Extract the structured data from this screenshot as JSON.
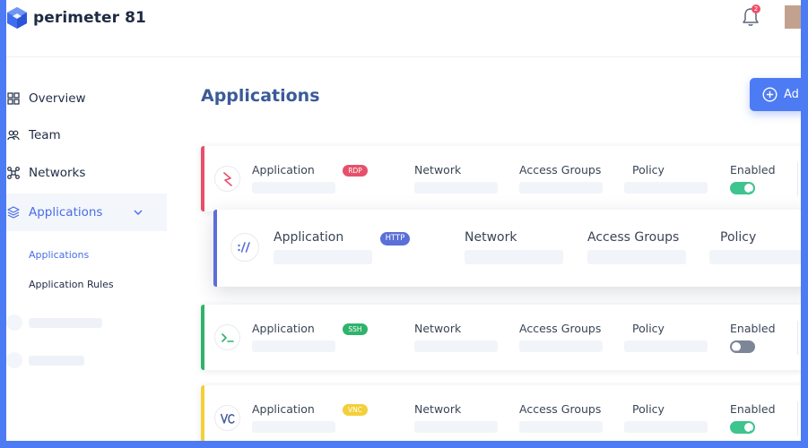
{
  "brand": {
    "name": "perimeter 81"
  },
  "notifications": {
    "count": "2"
  },
  "sidebar": {
    "items": [
      {
        "label": "Overview",
        "icon": "grid-icon"
      },
      {
        "label": "Team",
        "icon": "users-icon"
      },
      {
        "label": "Networks",
        "icon": "network-icon"
      },
      {
        "label": "Applications",
        "icon": "layers-icon",
        "active": true
      }
    ],
    "sub_items": [
      {
        "label": "Applications",
        "active": true
      },
      {
        "label": "Application Rules"
      }
    ]
  },
  "main": {
    "title": "Applications",
    "add_button_label": "Ad"
  },
  "columns": {
    "application": "Application",
    "network": "Network",
    "access_groups": "Access Groups",
    "policy": "Policy",
    "enabled": "Enabled"
  },
  "apps": [
    {
      "tag": "RDP",
      "accent": "#e7506b",
      "tag_color": "#e7506b",
      "enabled": true
    },
    {
      "tag": "HTTP",
      "accent": "#5b6fd8",
      "tag_color": "#5b6fd8"
    },
    {
      "tag": "SSH",
      "accent": "#2fb36b",
      "tag_color": "#2fb36b",
      "enabled": false
    },
    {
      "tag": "VNC",
      "accent": "#f3cf3a",
      "tag_color": "#f3cf3a",
      "enabled": true
    }
  ],
  "colors": {
    "accent": "#4d7bf3",
    "toggle_on": "#3ec48f",
    "toggle_off": "#7c8696"
  }
}
